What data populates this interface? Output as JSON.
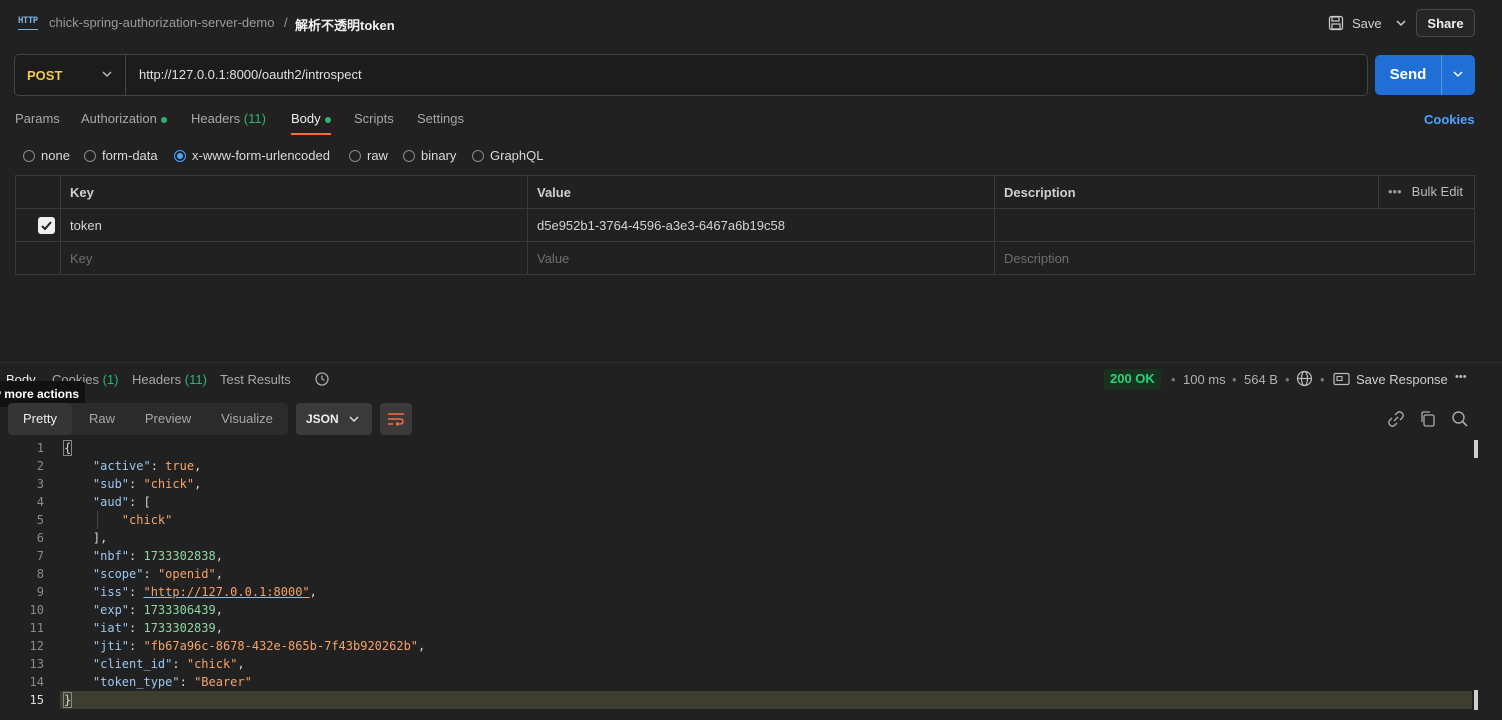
{
  "header": {
    "collection": "chick-spring-authorization-server-demo",
    "separator": "/",
    "request_name": "解析不透明token",
    "save_label": "Save",
    "share_label": "Share",
    "icon": "http-icon"
  },
  "request": {
    "method": "POST",
    "url": "http://127.0.0.1:8000/oauth2/introspect",
    "send_label": "Send"
  },
  "tabs": {
    "params": "Params",
    "authorization": "Authorization",
    "headers": "Headers",
    "headers_count": "(11)",
    "body": "Body",
    "scripts": "Scripts",
    "settings": "Settings",
    "cookies": "Cookies"
  },
  "body_types": {
    "none": "none",
    "form_data": "form-data",
    "urlencoded": "x-www-form-urlencoded",
    "raw": "raw",
    "binary": "binary",
    "graphql": "GraphQL",
    "selected": "x-www-form-urlencoded"
  },
  "params_table": {
    "headers": {
      "key": "Key",
      "value": "Value",
      "description": "Description",
      "bulk_edit": "Bulk Edit"
    },
    "row": {
      "key": "token",
      "value": "d5e952b1-3764-4596-a3e3-6467a6b19c58",
      "checked": true
    },
    "placeholders": {
      "key": "Key",
      "value": "Value",
      "description": "Description"
    }
  },
  "response": {
    "tab_body": "Body",
    "tab_cookies": "Cookies",
    "cookies_count": "(1)",
    "tab_headers": "Headers",
    "headers_count": "(11)",
    "tab_tests": "Test Results",
    "tooltip": "View more actions",
    "status": "200 OK",
    "time": "100 ms",
    "size": "564 B",
    "save_response": "Save Response",
    "views": {
      "pretty": "Pretty",
      "raw": "Raw",
      "preview": "Preview",
      "visualize": "Visualize"
    },
    "format": "JSON",
    "status_color": "#2bd17a"
  },
  "code": {
    "line_numbers": [
      "1",
      "2",
      "3",
      "4",
      "5",
      "6",
      "7",
      "8",
      "9",
      "10",
      "11",
      "12",
      "13",
      "14",
      "15"
    ],
    "active": "true",
    "sub": "\"chick\"",
    "aud_item": "\"chick\"",
    "nbf": "1733302838",
    "scope": "\"openid\"",
    "iss": "\"http://127.0.0.1:8000\"",
    "exp": "1733306439",
    "iat": "1733302839",
    "jti": "\"fb67a96c-8678-432e-865b-7f43b920262b\"",
    "client_id": "\"chick\"",
    "token_type": "\"Bearer\""
  }
}
